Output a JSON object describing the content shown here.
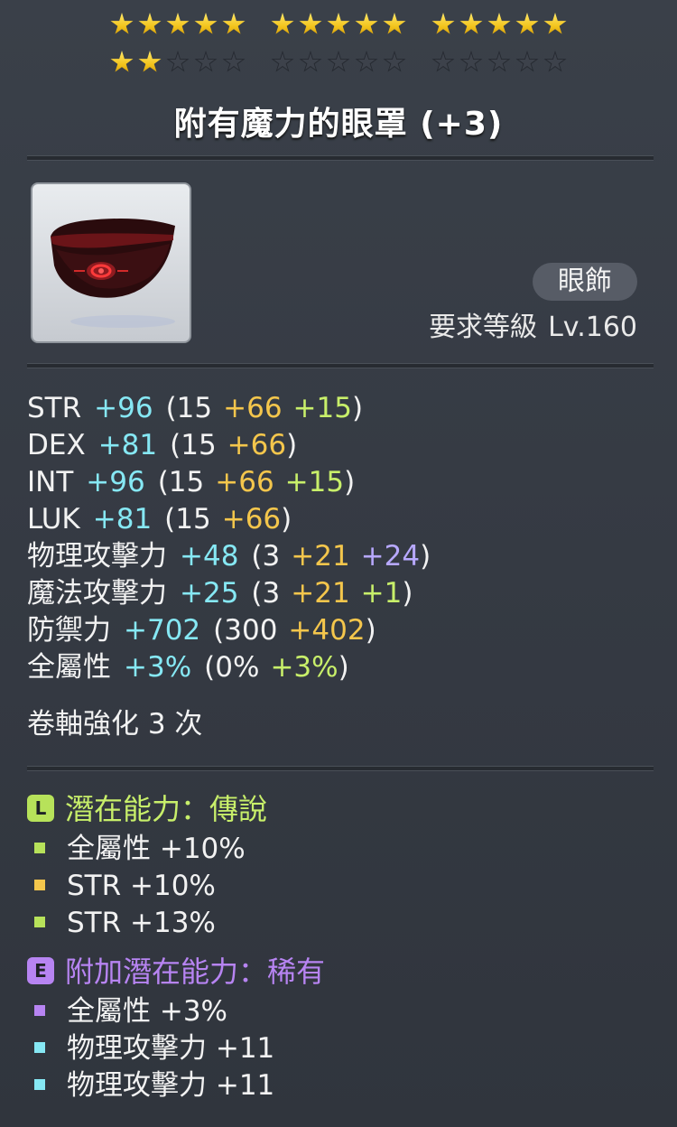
{
  "stars": {
    "filled": 17,
    "total": 30,
    "group_size": 5
  },
  "item": {
    "name": "附有魔力的眼罩 (+3)",
    "type": "眼飾",
    "req_label": "要求等級",
    "req_value": "Lv.160"
  },
  "stats": [
    {
      "name": "STR",
      "total": "+96",
      "open": "(15",
      "mid": "+66",
      "extra": "+15",
      "close": ")",
      "extra_color": "green"
    },
    {
      "name": "DEX",
      "total": "+81",
      "open": "(15",
      "mid": "+66",
      "extra": "",
      "close": ")",
      "extra_color": "green"
    },
    {
      "name": "INT",
      "total": "+96",
      "open": "(15",
      "mid": "+66",
      "extra": "+15",
      "close": ")",
      "extra_color": "green"
    },
    {
      "name": "LUK",
      "total": "+81",
      "open": "(15",
      "mid": "+66",
      "extra": "",
      "close": ")",
      "extra_color": "green"
    },
    {
      "name": "物理攻擊力",
      "total": "+48",
      "open": "(3",
      "mid": "+21",
      "extra": "+24",
      "close": ")",
      "extra_color": "violet"
    },
    {
      "name": "魔法攻擊力",
      "total": "+25",
      "open": "(3",
      "mid": "+21",
      "extra": "+1",
      "close": ")",
      "extra_color": "green"
    },
    {
      "name": "防禦力",
      "total": "+702",
      "open": "(300",
      "mid": "+402",
      "extra": "",
      "close": ")",
      "extra_color": "green"
    },
    {
      "name": "全屬性",
      "total": "+3%",
      "open": "(0%",
      "mid": "",
      "extra": "+3%",
      "close": ")",
      "extra_color": "green"
    }
  ],
  "scroll": "卷軸強化 3 次",
  "potential": {
    "badge": "L",
    "header": "潛在能力：傳說",
    "lines": [
      {
        "text": "全屬性 +10%",
        "bullet": "#b7e25a"
      },
      {
        "text": "STR +10%",
        "bullet": "#f4c64c"
      },
      {
        "text": "STR +13%",
        "bullet": "#b7e25a"
      }
    ]
  },
  "additional_potential": {
    "badge": "E",
    "header": "附加潛在能力：稀有",
    "lines": [
      {
        "text": "全屬性 +3%",
        "bullet": "#b784f2"
      },
      {
        "text": "物理攻擊力 +11",
        "bullet": "#86e8f4"
      },
      {
        "text": "物理攻擊力 +11",
        "bullet": "#86e8f4"
      }
    ]
  }
}
